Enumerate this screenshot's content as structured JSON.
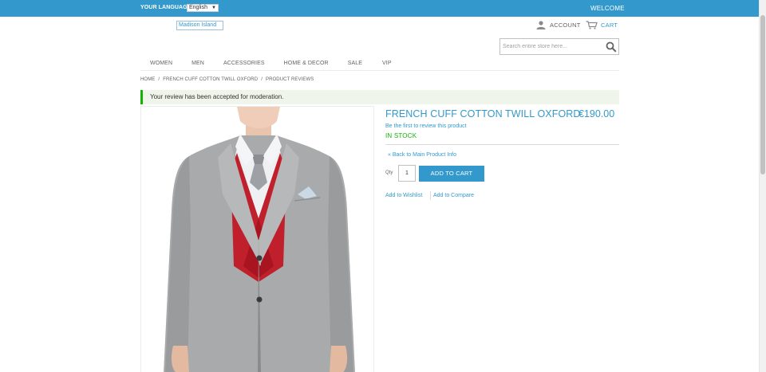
{
  "topbar": {
    "language_label": "YOUR LANGUAGE",
    "language_selected": "English",
    "welcome": "WELCOME"
  },
  "header": {
    "logo_alt": "Madison Island",
    "account_label": "ACCOUNT",
    "cart_label": "CART",
    "search_placeholder": "Search entire store here..."
  },
  "nav": {
    "items": [
      "WOMEN",
      "MEN",
      "ACCESSORIES",
      "HOME & DECOR",
      "SALE",
      "VIP"
    ]
  },
  "breadcrumb": {
    "items": [
      "HOME",
      "FRENCH CUFF COTTON TWILL OXFORD",
      "PRODUCT REVIEWS"
    ],
    "separator": "/"
  },
  "message": {
    "text": "Your review has been accepted for moderation."
  },
  "product": {
    "name": "FRENCH CUFF COTTON TWILL OXFORD",
    "price": "€190.00",
    "review_link": "Be the first to review this product",
    "stock": "IN STOCK",
    "back_link": "« Back to Main Product Info",
    "qty_label": "Qty",
    "qty_value": "1",
    "add_to_cart": "ADD TO CART",
    "wishlist": "Add to Wishlist",
    "compare": "Add to Compare"
  },
  "colors": {
    "accent": "#3399cc",
    "success": "#11b400",
    "message_bg": "#eff5ea"
  }
}
